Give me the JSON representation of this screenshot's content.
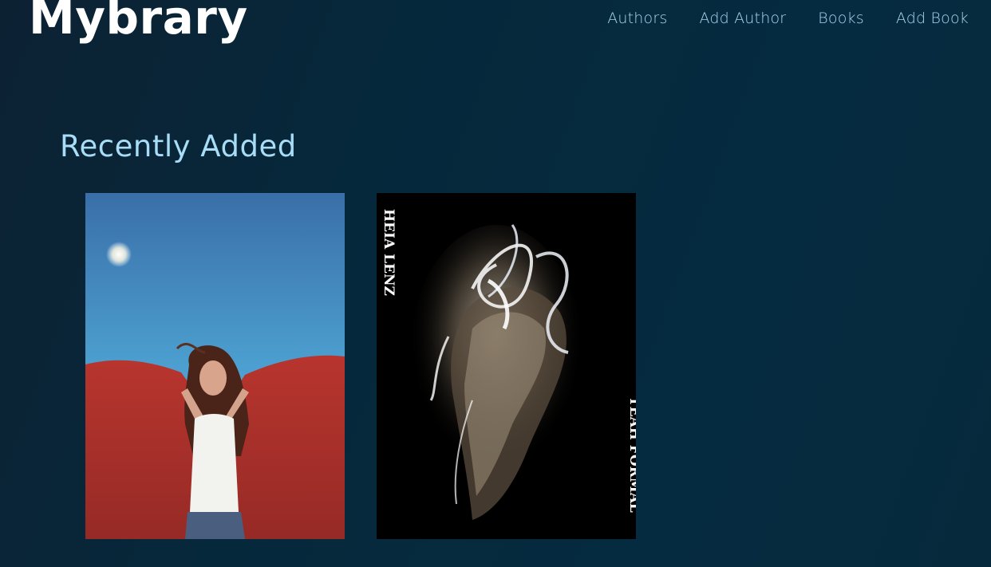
{
  "header": {
    "logo": "Mybrary",
    "nav": [
      {
        "label": "Authors"
      },
      {
        "label": "Add Author"
      },
      {
        "label": "Books"
      },
      {
        "label": "Add Book"
      }
    ]
  },
  "main": {
    "title": "Recently Added",
    "books": [
      {
        "cover": "cover-red-cape-sky"
      },
      {
        "cover": "cover-light-painting-dancer",
        "spine_text_top": "HEIA LENZ",
        "spine_text_bottom": "TEAH FORMAL"
      }
    ]
  },
  "colors": {
    "background": "#06283b",
    "logo": "#ffffff",
    "nav_link": "#a9d6ee",
    "title": "#a8ddf7"
  }
}
